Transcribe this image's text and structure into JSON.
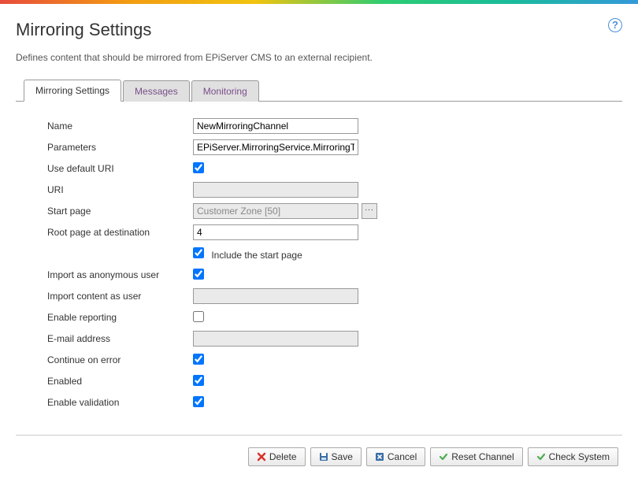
{
  "header": {
    "title": "Mirroring Settings",
    "description": "Defines content that should be mirrored from EPiServer CMS to an external recipient."
  },
  "tabs": [
    {
      "label": "Mirroring Settings",
      "active": true
    },
    {
      "label": "Messages",
      "active": false
    },
    {
      "label": "Monitoring",
      "active": false
    }
  ],
  "form": {
    "name": {
      "label": "Name",
      "value": "NewMirroringChannel"
    },
    "parameters": {
      "label": "Parameters",
      "value": "EPiServer.MirroringService.MirroringTransf"
    },
    "useDefaultUri": {
      "label": "Use default URI",
      "checked": true
    },
    "uri": {
      "label": "URI",
      "value": ""
    },
    "startPage": {
      "label": "Start page",
      "value": "Customer Zone [50]"
    },
    "rootPage": {
      "label": "Root page at destination",
      "value": "4"
    },
    "includeStart": {
      "label": "Include the start page",
      "checked": true
    },
    "importAnon": {
      "label": "Import as anonymous user",
      "checked": true
    },
    "importAsUser": {
      "label": "Import content as user",
      "value": ""
    },
    "enableReporting": {
      "label": "Enable reporting",
      "checked": false
    },
    "email": {
      "label": "E-mail address",
      "value": ""
    },
    "continueOnError": {
      "label": "Continue on error",
      "checked": true
    },
    "enabled": {
      "label": "Enabled",
      "checked": true
    },
    "enableValidation": {
      "label": "Enable validation",
      "checked": true
    }
  },
  "buttons": {
    "delete": "Delete",
    "save": "Save",
    "cancel": "Cancel",
    "reset": "Reset Channel",
    "check": "Check System"
  }
}
